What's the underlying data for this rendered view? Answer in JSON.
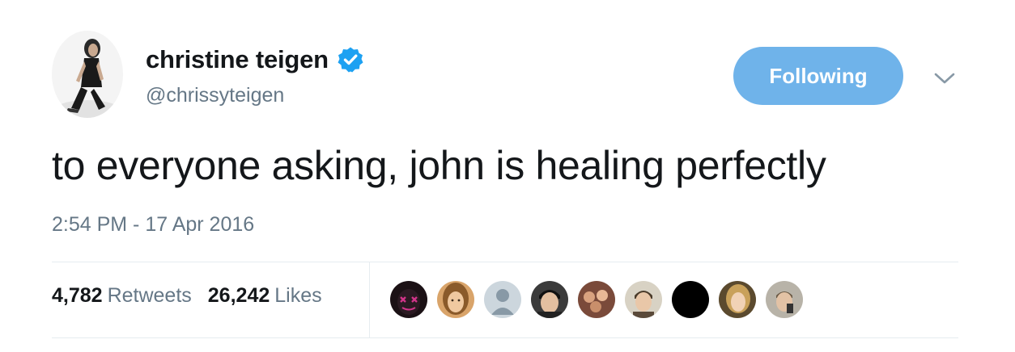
{
  "author": {
    "display_name": "christine teigen",
    "handle": "@chrissyteigen",
    "verified": true,
    "avatar_icon": "profile-photo"
  },
  "follow_button": {
    "label": "Following"
  },
  "menu": {
    "icon": "chevron-down-icon"
  },
  "tweet": {
    "text": "to everyone asking, john is healing perfectly",
    "timestamp": "2:54 PM - 17 Apr 2016"
  },
  "stats": {
    "retweets_count": "4,782",
    "retweets_label": "Retweets",
    "likes_count": "26,242",
    "likes_label": "Likes"
  },
  "likers": [
    {
      "icon": "liker-avatar-1"
    },
    {
      "icon": "liker-avatar-2"
    },
    {
      "icon": "liker-avatar-default"
    },
    {
      "icon": "liker-avatar-4"
    },
    {
      "icon": "liker-avatar-5"
    },
    {
      "icon": "liker-avatar-6"
    },
    {
      "icon": "liker-avatar-7"
    },
    {
      "icon": "liker-avatar-8"
    },
    {
      "icon": "liker-avatar-9"
    }
  ],
  "colors": {
    "accent": "#1da1f2",
    "following_button": "#6fb3ea",
    "text_primary": "#14171a",
    "text_secondary": "#657786",
    "divider": "#e6ecf0"
  }
}
